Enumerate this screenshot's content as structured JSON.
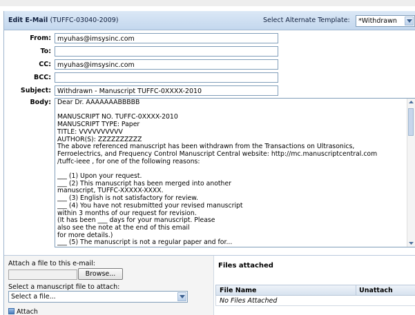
{
  "header": {
    "title": "Edit E-Mail",
    "title_id": "(TUFFC-03040-2009)",
    "template_label": "Select Alternate Template:",
    "template_value": "*Withdrawn"
  },
  "fields": {
    "from_label": "From:",
    "from_value": "myuhas@imsysinc.com",
    "to_label": "To:",
    "to_value": "",
    "cc_label": "CC:",
    "cc_value": "myuhas@imsysinc.com",
    "bcc_label": "BCC:",
    "bcc_value": "",
    "subject_label": "Subject:",
    "subject_value": "Withdrawn - Manuscript TUFFC-0XXXX-2010",
    "body_label": "Body:"
  },
  "body_lines": [
    "Dear Dr. AAAAAAABBBBB",
    "",
    "MANUSCRIPT NO. TUFFC-0XXXX-2010",
    "MANUSCRIPT TYPE: Paper",
    "TITLE: VVVVVVVVVV",
    "AUTHOR(S): ZZZZZZZZZZ",
    "The above referenced manuscript has been withdrawn from the Transactions on Ultrasonics,",
    "Ferroelectrics, and Frequency Control Manuscript Central website: http://mc.manuscriptcentral.com",
    "/tuffc-ieee , for one of the following reasons:",
    "",
    "___ (1) Upon your request.",
    "___ (2) This manuscript has been merged into another",
    "manuscript, TUFFC-XXXXX-XXXX.",
    "___ (3) English is not satisfactory for review.",
    "___ (4) You have not resubmitted your revised manuscript",
    "within 3 months of our request for revision.",
    "(It has been ___ days for your manuscript. Please",
    "also see the note at the end of this email",
    "for more details.)",
    "___ (5) The manuscript is not a regular paper and for..."
  ],
  "attach": {
    "label": "Attach a file to this e-mail:",
    "browse_label": "Browse...",
    "select_label": "Select a manuscript file to attach:",
    "select_value": "Select a file...",
    "attach_button": "Attach"
  },
  "files": {
    "title": "Files attached",
    "col_name": "File Name",
    "col_unattach": "Unattach",
    "empty_text": "No Files Attached"
  }
}
